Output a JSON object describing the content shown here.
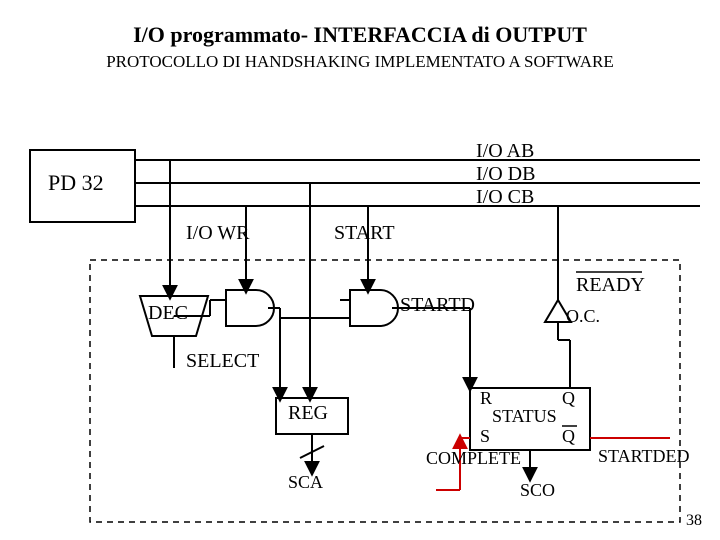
{
  "title": "I/O programmato- INTERFACCIA di OUTPUT",
  "subtitle": "PROTOCOLLO DI HANDSHAKING IMPLEMENTATO A SOFTWARE",
  "pd32": "PD 32",
  "io_wr": "I/O WR",
  "start": "START",
  "io_ab": "I/O AB",
  "io_db": "I/O DB",
  "io_cb": "I/O CB",
  "dec": "DEC",
  "startd": "STARTD",
  "ready": "READY",
  "oc": "O.C.",
  "select": "SELECT",
  "reg": "REG",
  "r": "R",
  "q": "Q",
  "status": "STATUS",
  "s": "S",
  "qbar": "Q",
  "complete": "COMPLETE",
  "startded": "STARTDED",
  "sca": "SCA",
  "sco": "SCO",
  "page": "38"
}
